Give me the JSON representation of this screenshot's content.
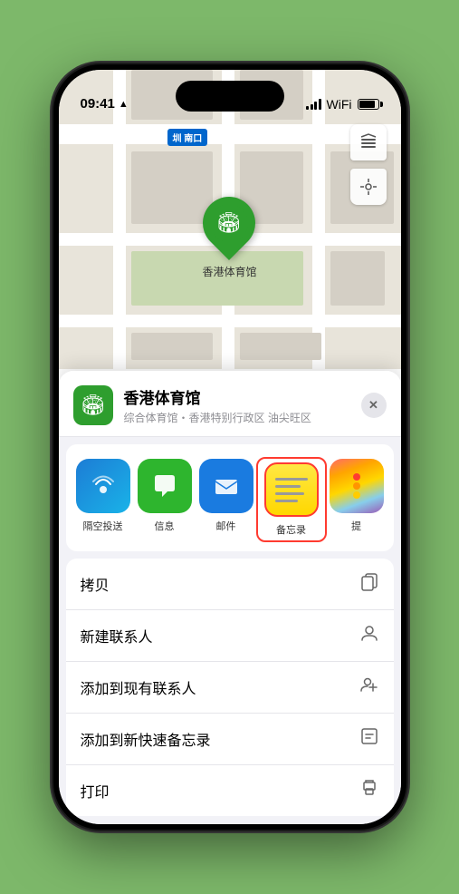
{
  "status_bar": {
    "time": "09:41",
    "location_indicator": "▲"
  },
  "map": {
    "pin_label": "香港体育馆",
    "metro_label": "南口"
  },
  "location_header": {
    "name": "香港体育馆",
    "subtitle": "综合体育馆・香港特别行政区 油尖旺区",
    "close_label": "✕"
  },
  "share_apps": [
    {
      "id": "airdrop",
      "label": "隔空投送",
      "icon": "📡"
    },
    {
      "id": "messages",
      "label": "信息",
      "icon": "💬"
    },
    {
      "id": "mail",
      "label": "邮件",
      "icon": "✉️"
    },
    {
      "id": "notes",
      "label": "备忘录",
      "icon": "notes"
    },
    {
      "id": "more",
      "label": "提",
      "icon": "more"
    }
  ],
  "action_items": [
    {
      "id": "copy",
      "label": "拷贝",
      "icon": "⎘"
    },
    {
      "id": "new-contact",
      "label": "新建联系人",
      "icon": "👤"
    },
    {
      "id": "add-existing",
      "label": "添加到现有联系人",
      "icon": "👤+"
    },
    {
      "id": "add-notes",
      "label": "添加到新快速备忘录",
      "icon": "📋"
    },
    {
      "id": "print",
      "label": "打印",
      "icon": "🖨️"
    }
  ],
  "colors": {
    "green": "#2e9e2e",
    "background": "#7db86a",
    "map_bg": "#e8e4da",
    "sheet_bg": "#f2f2f7",
    "notes_border": "#ff3b30"
  }
}
